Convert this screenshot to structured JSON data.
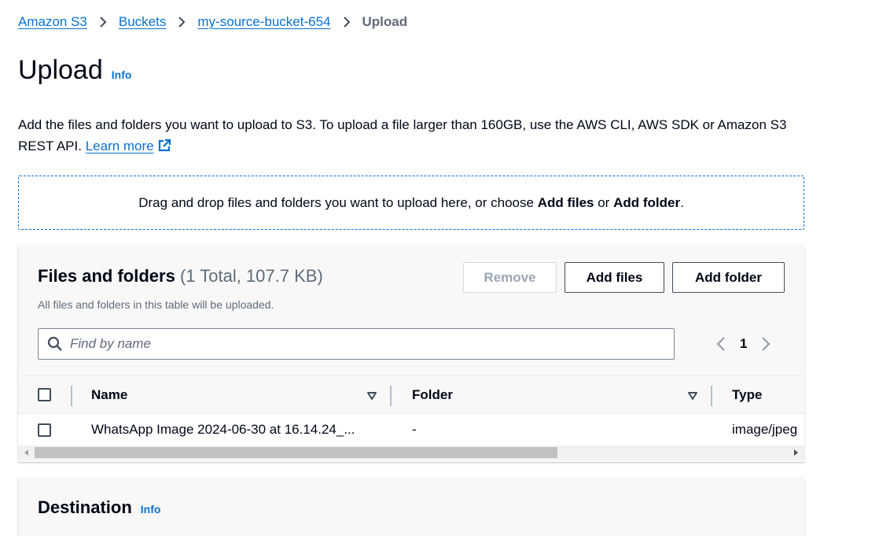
{
  "breadcrumb": {
    "items": [
      "Amazon S3",
      "Buckets",
      "my-source-bucket-654"
    ],
    "current": "Upload"
  },
  "page": {
    "title": "Upload",
    "info": "Info",
    "description": "Add the files and folders you want to upload to S3. To upload a file larger than 160GB, use the AWS CLI, AWS SDK or Amazon S3 REST API.",
    "learn_more": "Learn more"
  },
  "dropzone": {
    "prefix": "Drag and drop files and folders you want to upload here, or choose ",
    "add_files": "Add files",
    "or": " or ",
    "add_folder": "Add folder",
    "suffix": "."
  },
  "files_panel": {
    "title": "Files and folders",
    "count": "(1 Total, 107.7 KB)",
    "subtitle": "All files and folders in this table will be uploaded.",
    "buttons": {
      "remove": "Remove",
      "add_files": "Add files",
      "add_folder": "Add folder"
    },
    "search_placeholder": "Find by name",
    "page_number": "1",
    "columns": [
      "Name",
      "Folder",
      "Type"
    ],
    "rows": [
      {
        "name": "WhatsApp Image 2024-06-30 at 16.14.24_...",
        "folder": "-",
        "type": "image/jpeg"
      }
    ]
  },
  "destination": {
    "title": "Destination",
    "info": "Info"
  },
  "colors": {
    "link": "#0972d3",
    "text": "#000716",
    "muted": "#5f6b7a"
  }
}
